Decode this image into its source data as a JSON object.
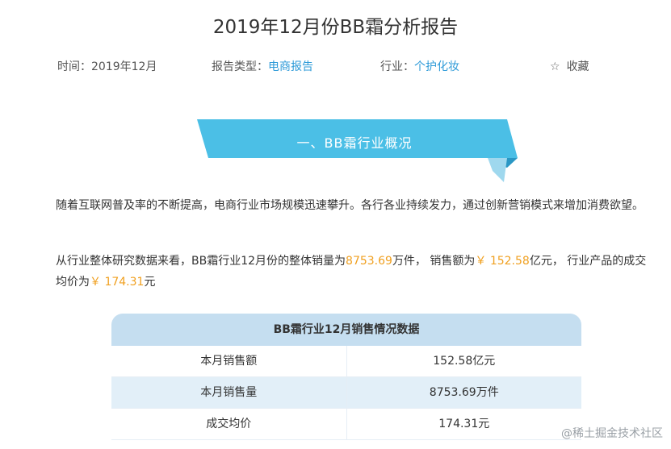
{
  "header": {
    "title": "2019年12月份BB霜分析报告"
  },
  "meta": {
    "time_label": "时间：",
    "time_value": "2019年12月",
    "type_label": "报告类型：",
    "type_value": "电商报告",
    "industry_label": "行业：",
    "industry_value": "个护化妆",
    "favorite_label": "收藏",
    "favorite_icon": "star-outline"
  },
  "section": {
    "heading": "一、BB霜行业概况"
  },
  "paragraphs": {
    "p1": "随着互联网普及率的不断提高，电商行业市场规模迅速攀升。各行各业持续发力，通过创新营销模式来增加消费欲望。",
    "p2_a": "从行业整体研究数据来看，BB霜行业12月份的整体销量为",
    "p2_sales": "8753.69",
    "p2_b": "万件， 销售额为",
    "p2_revenue": "￥ 152.58",
    "p2_c": "亿元， 行业产品的成交均价为",
    "p2_price": "￥ 174.31",
    "p2_d": "元"
  },
  "table": {
    "title": "BB霜行业12月销售情况数据",
    "rows": [
      {
        "label": "本月销售额",
        "value": "152.58亿元"
      },
      {
        "label": "本月销售量",
        "value": "8753.69万件"
      },
      {
        "label": "成交均价",
        "value": "174.31元"
      }
    ]
  },
  "watermark": "@稀土掘金技术社区",
  "colors": {
    "banner": "#4bbfe6",
    "banner_fold": "#2a97c4",
    "link": "#2f9bd8",
    "highlight": "#f0a020",
    "table_head": "#c5def0",
    "table_alt": "#e2eff8"
  }
}
